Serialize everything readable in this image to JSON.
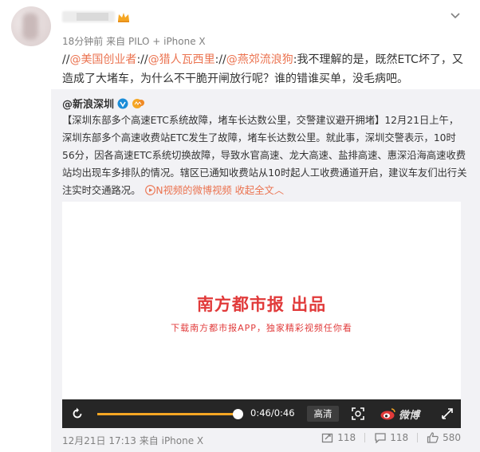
{
  "header": {
    "time": "18分钟前",
    "source_prefix": "来自",
    "source": "PILO + iPhone X"
  },
  "comment": {
    "prefix1": "//",
    "mention1": "@美国创业者",
    "sep1": ":",
    "prefix2": "//",
    "mention2": "@猎人瓦西里",
    "sep2": ":",
    "prefix3": "//",
    "mention3": "@燕郊流浪狗",
    "body": ":我不理解的是，既然ETC坏了，又造成了大堵车，为什么不干脆开闸放行呢？谁的错谁买单，没毛病吧。"
  },
  "original": {
    "author": "@新浪深圳",
    "text": "【深圳东部多个高速ETC系统故障，堵车长达数公里，交警建议避开拥堵】12月21日上午，深圳东部多个高速收费站ETC发生了故障，堵车长达数公里。就此事，深圳交警表示，10时56分，因各高速ETC系统切换故障，导致水官高速、龙大高速、盐排高速、惠深沿海高速收费站均出现车多排队的情况。辖区已通知收费站从10时起人工收费通道开启，建议车友们出行关注实时交通路况。",
    "video_link": "N视频的微博视频",
    "collapse": "收起全文",
    "collapse_arrow": "︿"
  },
  "video": {
    "brand_title": "南方都市报 出品",
    "brand_sub": "下载南方都市报APP，独家精彩视频任你看",
    "time": "0:46/0:46",
    "quality": "高清",
    "progress": 1.0,
    "logo_text": "微博"
  },
  "footer": {
    "date": "12月21日 17:13",
    "source_prefix": "来自",
    "source": "iPhone X",
    "forwards": "118",
    "comments": "118",
    "likes": "580"
  },
  "colors": {
    "link": "#eb7350",
    "brand_red": "#e13a3a",
    "progress": "#f5a623",
    "player_bar": "#262626",
    "retweet_bg": "#f2f2f5"
  }
}
